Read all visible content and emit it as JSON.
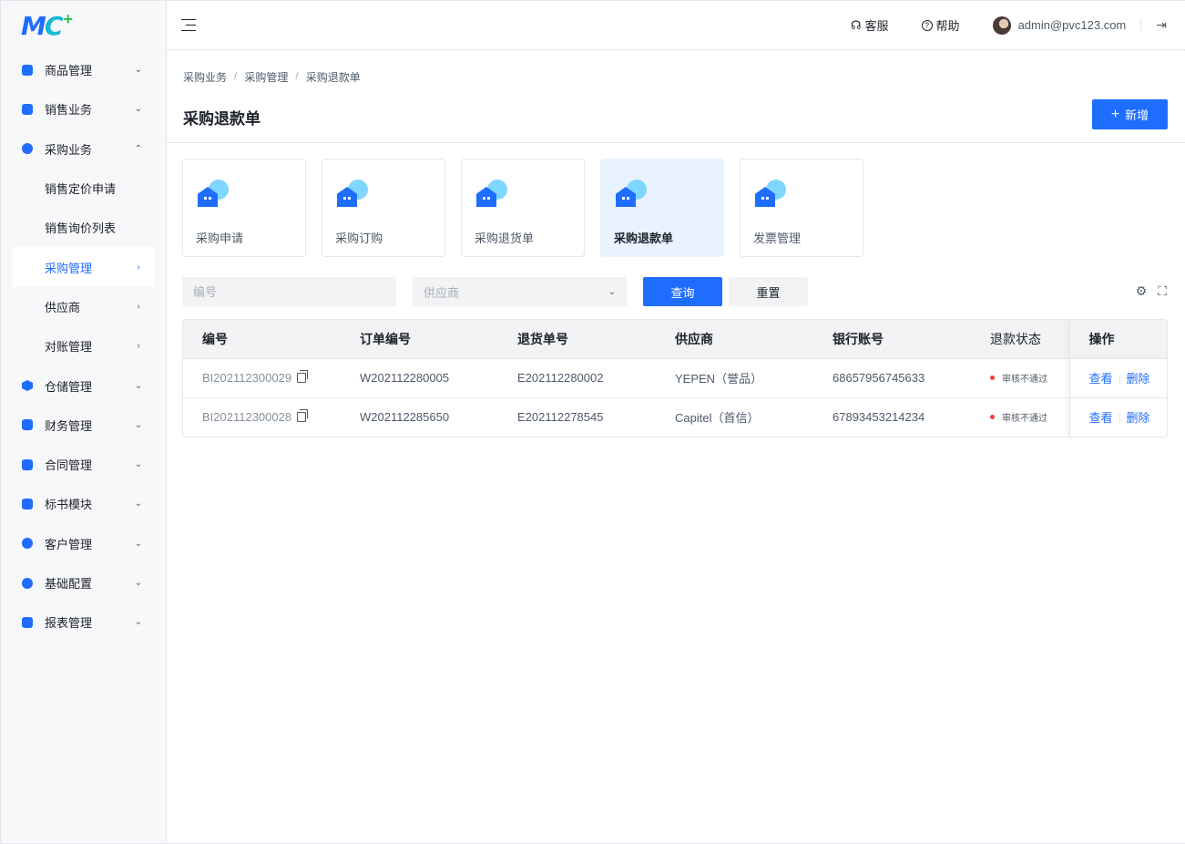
{
  "logo": {
    "m": "M",
    "c": "C",
    "plus": "+"
  },
  "sidebar": {
    "items": [
      {
        "label": "商品管理",
        "chev": "⌄"
      },
      {
        "label": "销售业务",
        "chev": "⌄"
      },
      {
        "label": "采购业务",
        "chev": "⌃"
      },
      {
        "label": "销售定价申请",
        "chev": ""
      },
      {
        "label": "销售询价列表",
        "chev": ""
      },
      {
        "label": "采购管理",
        "chev": "›"
      },
      {
        "label": "供应商",
        "chev": "›"
      },
      {
        "label": "对账管理",
        "chev": "›"
      },
      {
        "label": "仓储管理",
        "chev": "⌄"
      },
      {
        "label": "财务管理",
        "chev": "⌄"
      },
      {
        "label": "合同管理",
        "chev": "⌄"
      },
      {
        "label": "标书模块",
        "chev": "⌄"
      },
      {
        "label": "客户管理",
        "chev": "⌄"
      },
      {
        "label": "基础配置",
        "chev": "⌄"
      },
      {
        "label": "报表管理",
        "chev": "⌄"
      }
    ]
  },
  "header": {
    "service": "客服",
    "help": "帮助",
    "user": "admin@pvc123.com",
    "service_glyph": "☊",
    "help_glyph": "?",
    "logout_glyph": "⇥"
  },
  "breadcrumb": [
    "采购业务",
    "采购管理",
    "采购退款单"
  ],
  "breadcrumb_sep": "/",
  "page": {
    "title": "采购退款单",
    "add_label": "新增",
    "add_plus": "+"
  },
  "cards": [
    {
      "label": "采购申请"
    },
    {
      "label": "采购订购"
    },
    {
      "label": "采购退货单"
    },
    {
      "label": "采购退款单"
    },
    {
      "label": "发票管理"
    }
  ],
  "filters": {
    "code_placeholder": "编号",
    "supplier_placeholder": "供应商",
    "select_arrow": "⌄",
    "query_label": "查询",
    "reset_label": "重置"
  },
  "tools": {
    "settings_glyph": "⚙",
    "fullscreen_glyph": "⛶"
  },
  "table": {
    "columns": [
      "编号",
      "订单编号",
      "退货单号",
      "供应商",
      "银行账号",
      "退款状态",
      "操作"
    ],
    "rows": [
      {
        "code": "BI202112300029",
        "order": "W202112280005",
        "return": "E202112280002",
        "supplier": "YEPEN（誉品）",
        "account": "68657956745633",
        "status": "审核不通过",
        "view": "查看",
        "delete": "删除"
      },
      {
        "code": "BI202112300028",
        "order": "W202112285650",
        "return": "E202112278545",
        "supplier": "Capitel（首信）",
        "account": "67893453214234",
        "status": "审核不通过",
        "view": "查看",
        "delete": "删除"
      }
    ]
  },
  "colors": {
    "primary": "#1e6dff",
    "danger": "#f53f3f",
    "active_bg": "#e8f3ff"
  }
}
